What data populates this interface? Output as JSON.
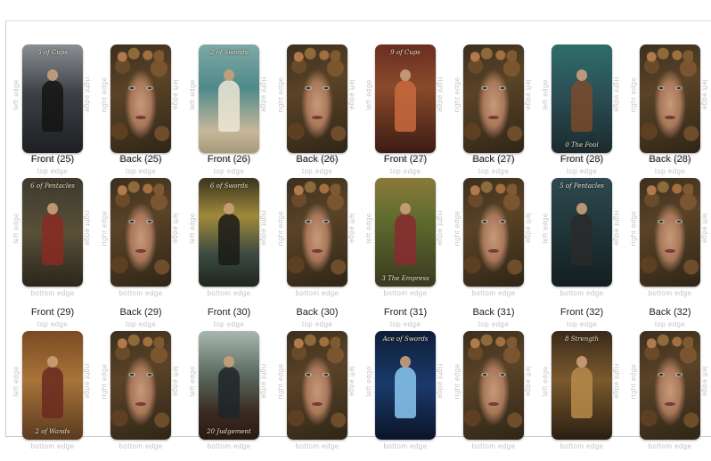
{
  "edges": {
    "top": "top edge",
    "bottom": "bottom edge",
    "left": "left edge",
    "right": "right edge"
  },
  "rows": [
    {
      "cells": [
        {
          "title": "",
          "kind": "front",
          "label": "5 of Cups",
          "label_pos": "top",
          "bg": "linear-gradient(180deg,#8a8f94 0%,#3d4146 45%,#1d1f22 100%)",
          "figure": "#141414"
        },
        {
          "title": "",
          "kind": "back"
        },
        {
          "title": "",
          "kind": "front",
          "label": "2 of Swords",
          "label_pos": "top",
          "bg": "linear-gradient(180deg,#7fa9a6 0%,#4f8a8a 40%,#c7b79a 80%,#a8987a 100%)",
          "figure": "#efe6d6"
        },
        {
          "title": "",
          "kind": "back"
        },
        {
          "title": "",
          "kind": "front",
          "label": "9 of Cups",
          "label_pos": "top",
          "bg": "linear-gradient(180deg,#6a2e22 0%,#8a4a2a 40%,#3c1c14 100%)",
          "figure": "#c96a3e"
        },
        {
          "title": "",
          "kind": "back"
        },
        {
          "title": "",
          "kind": "front",
          "label": "0 The Fool",
          "label_pos": "bot",
          "bg": "linear-gradient(180deg,#2f6e6a 0%,#2a4c52 50%,#1b2a2e 100%)",
          "figure": "#7a4a2a"
        },
        {
          "title": "",
          "kind": "back"
        }
      ]
    },
    {
      "cells": [
        {
          "title": "Front (25)",
          "kind": "front",
          "label": "6 of Pentacles",
          "label_pos": "top",
          "bg": "linear-gradient(180deg,#3d3a2e 0%,#5a5038 50%,#2a261c 100%)",
          "figure": "#8a2a22"
        },
        {
          "title": "Back (25)",
          "kind": "back"
        },
        {
          "title": "Front (26)",
          "kind": "front",
          "label": "6 of Swords",
          "label_pos": "top",
          "bg": "linear-gradient(180deg,#3a3420 0%,#a08a3a 35%,#3c4a40 70%,#1e2620 100%)",
          "figure": "#1a1a16"
        },
        {
          "title": "Back (26)",
          "kind": "back"
        },
        {
          "title": "Front (27)",
          "kind": "front",
          "label": "3 The Empress",
          "label_pos": "bot",
          "bg": "linear-gradient(180deg,#8a7a3a 0%,#5e6a2e 40%,#3a3a20 100%)",
          "figure": "#8a2a30"
        },
        {
          "title": "Back (27)",
          "kind": "back"
        },
        {
          "title": "Front (28)",
          "kind": "front",
          "label": "5 of Pentacles",
          "label_pos": "top",
          "bg": "linear-gradient(180deg,#2e4a50 0%,#1f3438 50%,#141e20 100%)",
          "figure": "#2a2a2a"
        },
        {
          "title": "Back (28)",
          "kind": "back"
        }
      ]
    },
    {
      "cells": [
        {
          "title": "Front (29)",
          "kind": "front",
          "label": "2 of Wands",
          "label_pos": "bot",
          "bg": "linear-gradient(180deg,#7a4a22 0%,#a8743a 45%,#5a3a1e 100%)",
          "figure": "#6a2a1e"
        },
        {
          "title": "Back (29)",
          "kind": "back"
        },
        {
          "title": "Front (30)",
          "kind": "front",
          "label": "20 Judgement",
          "label_pos": "bot",
          "bg": "linear-gradient(180deg,#a8b8b0 0%,#5a6a60 40%,#3a2a20 75%,#2a1a14 100%)",
          "figure": "#1e2428"
        },
        {
          "title": "Back (30)",
          "kind": "back"
        },
        {
          "title": "Front (31)",
          "kind": "front",
          "label": "Ace of Swords",
          "label_pos": "top",
          "bg": "linear-gradient(180deg,#0e1e3a 0%,#1a3a6a 50%,#0a1428 100%)",
          "figure": "#8ac8f0"
        },
        {
          "title": "Back (31)",
          "kind": "back"
        },
        {
          "title": "Front (32)",
          "kind": "front",
          "label": "8 Strength",
          "label_pos": "top",
          "bg": "linear-gradient(180deg,#3a2a1a 0%,#7a5a2e 45%,#2a1e12 100%)",
          "figure": "#b88a4a"
        },
        {
          "title": "Back (32)",
          "kind": "back"
        }
      ]
    }
  ]
}
